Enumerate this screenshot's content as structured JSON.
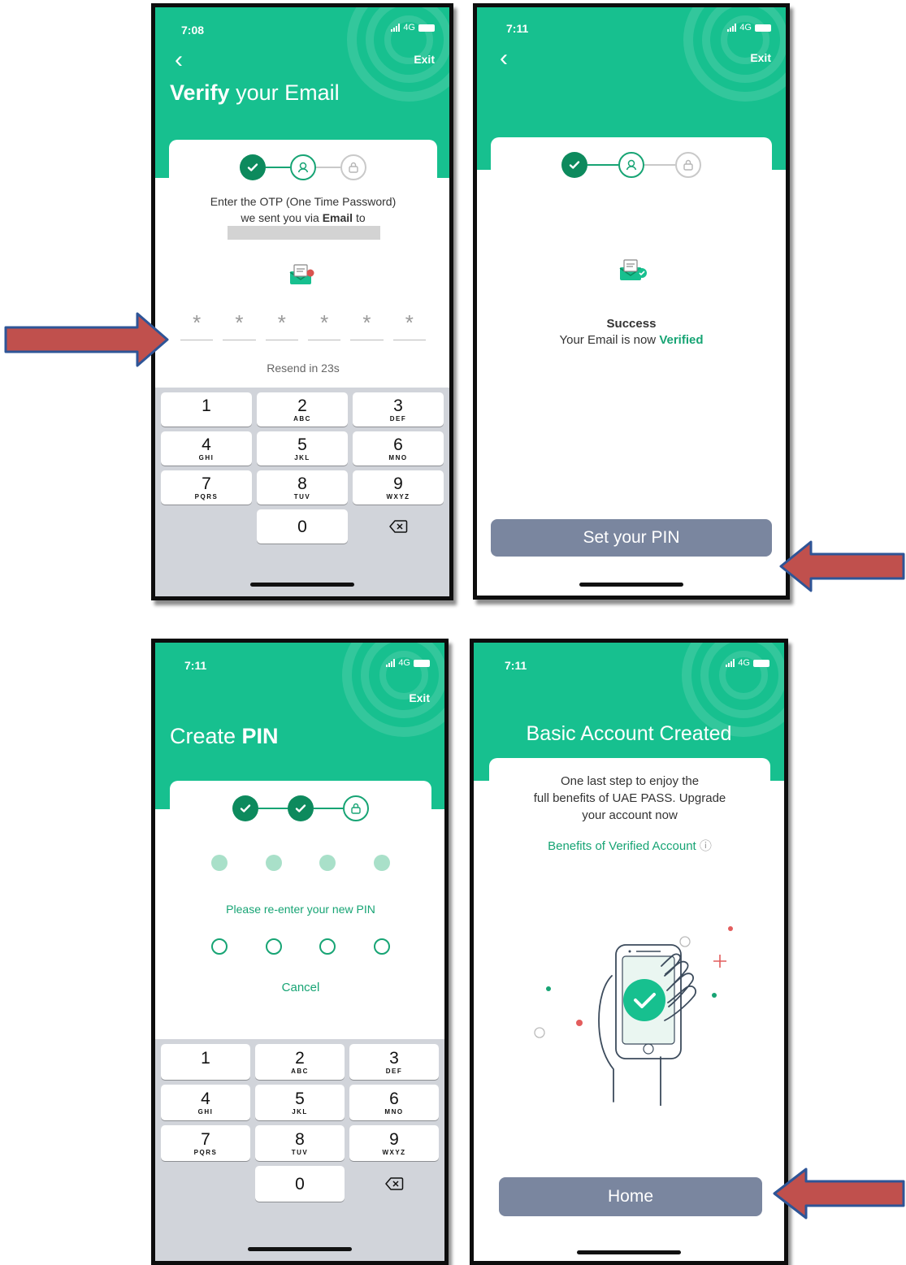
{
  "colors": {
    "brand": "#17c08f",
    "brand_dark": "#0d8a5d",
    "text_green": "#17a474",
    "button_gray": "#7a869f",
    "keyboard_bg": "#d1d4da",
    "arrow": "#c0504d"
  },
  "status": {
    "network": "4G"
  },
  "common": {
    "exit_label": "Exit",
    "back_icon": "chevron-left-icon"
  },
  "verify_email": {
    "time": "7:08",
    "title_bold": "Verify",
    "title_rest": " your Email",
    "instruction_line1": "Enter the OTP (One Time Password)",
    "instruction_line2_pre": "we sent you via ",
    "instruction_line2_bold": "Email",
    "instruction_line2_post": " to",
    "otp_mask": "*",
    "resend": "Resend in 23s"
  },
  "email_verified": {
    "time": "7:11",
    "success_title": "Success",
    "success_msg_pre": "Your Email is now ",
    "success_msg_bold": "Verified",
    "button_label": "Set your PIN"
  },
  "create_pin": {
    "time": "7:11",
    "title_light": "Create ",
    "title_bold": "PIN",
    "prompt": "Please re-enter your new PIN",
    "cancel": "Cancel"
  },
  "account_created": {
    "time": "7:11",
    "title": "Basic Account Created",
    "body_line1": "One last step to enjoy the",
    "body_line2": "full benefits of UAE PASS. Upgrade",
    "body_line3": "your account now",
    "benefits_link": "Benefits of Verified Account",
    "info_icon_glyph": "ⓘ",
    "button_label": "Home"
  },
  "keypad": {
    "rows": [
      [
        {
          "d": "1",
          "l": ""
        },
        {
          "d": "2",
          "l": "ABC"
        },
        {
          "d": "3",
          "l": "DEF"
        }
      ],
      [
        {
          "d": "4",
          "l": "GHI"
        },
        {
          "d": "5",
          "l": "JKL"
        },
        {
          "d": "6",
          "l": "MNO"
        }
      ],
      [
        {
          "d": "7",
          "l": "PQRS"
        },
        {
          "d": "8",
          "l": "TUV"
        },
        {
          "d": "9",
          "l": "WXYZ"
        }
      ]
    ],
    "zero": "0"
  }
}
